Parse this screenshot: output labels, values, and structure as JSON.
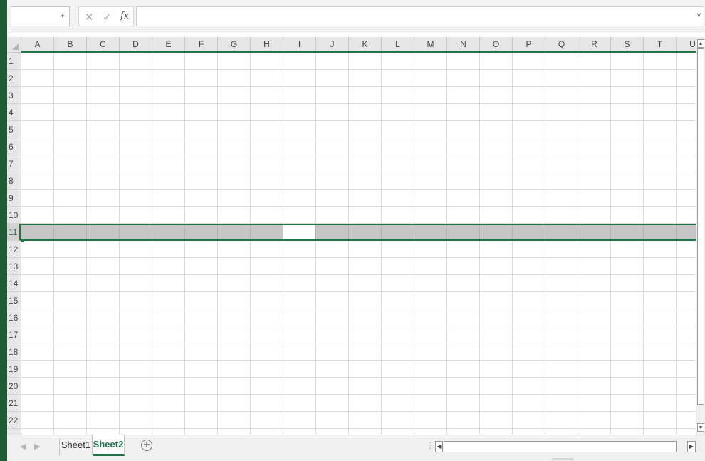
{
  "formula_bar": {
    "name_box_value": "",
    "formula_value": "",
    "cancel_symbol": "✕",
    "enter_symbol": "✓",
    "fx_label": "fx",
    "dropdown_symbol": "▾",
    "expand_symbol": "v",
    "separator_symbol": "⋮"
  },
  "columns": [
    "A",
    "B",
    "C",
    "D",
    "E",
    "F",
    "G",
    "H",
    "I",
    "J",
    "K",
    "L",
    "M",
    "N",
    "O",
    "P",
    "Q",
    "R",
    "S",
    "T",
    "U"
  ],
  "rows": [
    "1",
    "2",
    "3",
    "4",
    "5",
    "6",
    "7",
    "8",
    "9",
    "10",
    "11",
    "12",
    "13",
    "14",
    "15",
    "16",
    "17",
    "18",
    "19",
    "20",
    "21",
    "22"
  ],
  "selection": {
    "selected_row": "11",
    "active_cell": "I11"
  },
  "sheets": {
    "tabs": [
      {
        "label": "Sheet1",
        "active": false
      },
      {
        "label": "Sheet2",
        "active": true
      }
    ],
    "add_symbol": "+",
    "nav_prev": "◀",
    "nav_next": "▶",
    "splitter_symbol": "⋮"
  },
  "scrollbars": {
    "up_arrow": "▲",
    "down_arrow": "▼",
    "left_arrow": "◀",
    "right_arrow": "▶"
  },
  "colors": {
    "accent": "#217346",
    "frame": "#1f5c36",
    "header_bg": "#e6e6e6",
    "selection_bg": "#c6c6c6"
  }
}
